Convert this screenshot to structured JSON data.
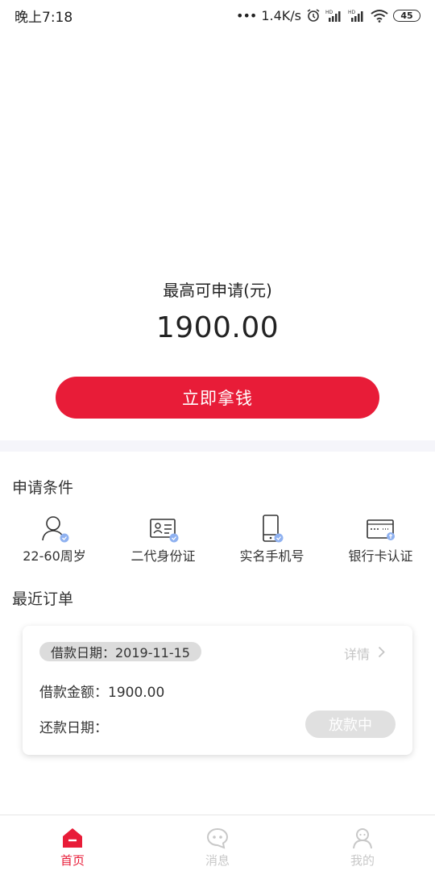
{
  "status_bar": {
    "time": "晚上7:18",
    "network_speed": "1.4K/s",
    "battery_level": "45",
    "icons": [
      "dots-icon",
      "alarm-icon",
      "hd-signal-icon",
      "hd-signal-icon",
      "wifi-icon",
      "battery-icon"
    ]
  },
  "hero": {
    "label": "最高可申请(元)",
    "amount": "1900.00",
    "cta_label": "立即拿钱"
  },
  "conditions": {
    "title": "申请条件",
    "items": [
      {
        "label": "22-60周岁",
        "icon": "person-verified-icon"
      },
      {
        "label": "二代身份证",
        "icon": "id-card-icon"
      },
      {
        "label": "实名手机号",
        "icon": "phone-verified-icon"
      },
      {
        "label": "银行卡认证",
        "icon": "bank-card-icon"
      }
    ]
  },
  "orders": {
    "title": "最近订单",
    "card": {
      "date_label": "借款日期：2019-11-15",
      "detail_label": "详情",
      "amount_label": "借款金额：1900.00",
      "repay_label": "还款日期：",
      "status_label": "放款中"
    }
  },
  "nav": {
    "items": [
      {
        "label": "首页",
        "icon": "home-icon",
        "active": true
      },
      {
        "label": "消息",
        "icon": "message-icon",
        "active": false
      },
      {
        "label": "我的",
        "icon": "profile-icon",
        "active": false
      }
    ]
  },
  "colors": {
    "accent": "#e81c38",
    "verified_badge": "#8fb1f0",
    "inactive": "#c8c8c8"
  }
}
